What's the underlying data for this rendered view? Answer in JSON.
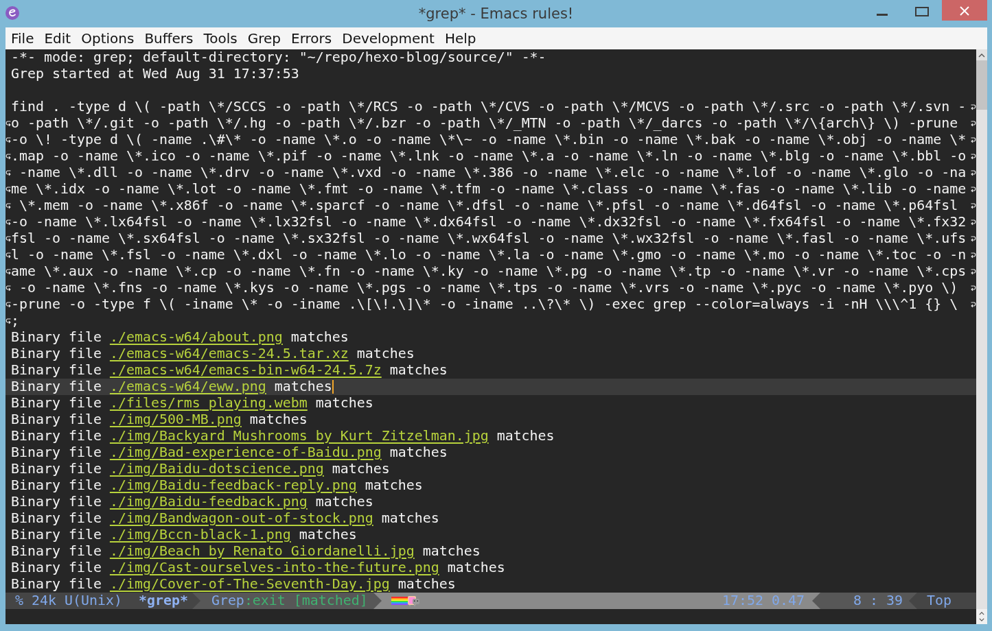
{
  "window": {
    "title": "*grep* - Emacs rules!"
  },
  "menu_bar": [
    "File",
    "Edit",
    "Options",
    "Buffers",
    "Tools",
    "Grep",
    "Errors",
    "Development",
    "Help"
  ],
  "buffer": {
    "header_lines": [
      "-*- mode: grep; default-directory: \"~/repo/hexo-blog/source/\" -*-",
      "Grep started at Wed Aug 31 17:37:53"
    ],
    "command_rows": [
      "find . -type d \\( -path \\*/SCCS -o -path \\*/RCS -o -path \\*/CVS -o -path \\*/MCVS -o -path \\*/.src -o -path \\*/.svn -",
      "o -path \\*/.git -o -path \\*/.hg -o -path \\*/.bzr -o -path \\*/_MTN -o -path \\*/_darcs -o -path \\*/\\{arch\\} \\) -prune",
      "-o \\! -type d \\( -name .\\#\\* -o -name \\*.o -o -name \\*\\~ -o -name \\*.bin -o -name \\*.bak -o -name \\*.obj -o -name \\*",
      ".map -o -name \\*.ico -o -name \\*.pif -o -name \\*.lnk -o -name \\*.a -o -name \\*.ln -o -name \\*.blg -o -name \\*.bbl -o",
      " -name \\*.dll -o -name \\*.drv -o -name \\*.vxd -o -name \\*.386 -o -name \\*.elc -o -name \\*.lof -o -name \\*.glo -o -na",
      "me \\*.idx -o -name \\*.lot -o -name \\*.fmt -o -name \\*.tfm -o -name \\*.class -o -name \\*.fas -o -name \\*.lib -o -name",
      " \\*.mem -o -name \\*.x86f -o -name \\*.sparcf -o -name \\*.dfsl -o -name \\*.pfsl -o -name \\*.d64fsl -o -name \\*.p64fsl",
      "-o -name \\*.lx64fsl -o -name \\*.lx32fsl -o -name \\*.dx64fsl -o -name \\*.dx32fsl -o -name \\*.fx64fsl -o -name \\*.fx32",
      "fsl -o -name \\*.sx64fsl -o -name \\*.sx32fsl -o -name \\*.wx64fsl -o -name \\*.wx32fsl -o -name \\*.fasl -o -name \\*.ufs",
      "l -o -name \\*.fsl -o -name \\*.dxl -o -name \\*.lo -o -name \\*.la -o -name \\*.gmo -o -name \\*.mo -o -name \\*.toc -o -n",
      "ame \\*.aux -o -name \\*.cp -o -name \\*.fn -o -name \\*.ky -o -name \\*.pg -o -name \\*.tp -o -name \\*.vr -o -name \\*.cps",
      " -o -name \\*.fns -o -name \\*.kys -o -name \\*.pgs -o -name \\*.tps -o -name \\*.vrs -o -name \\*.pyc -o -name \\*.pyo \\)",
      "-prune -o -type f \\( -iname \\* -o -iname .\\[\\!.\\]\\* -o -iname ..\\?\\* \\) -exec grep --color=always -i -nH \\\\\\^1 {} \\",
      ";"
    ],
    "results": [
      {
        "prefix": "Binary file",
        "path": "./emacs-w64/about.png",
        "suffix": "matches",
        "selected": false
      },
      {
        "prefix": "Binary file",
        "path": "./emacs-w64/emacs-24.5.tar.xz",
        "suffix": "matches",
        "selected": false
      },
      {
        "prefix": "Binary file",
        "path": "./emacs-w64/emacs-bin-w64-24.5.7z",
        "suffix": "matches",
        "selected": false
      },
      {
        "prefix": "Binary file",
        "path": "./emacs-w64/eww.png",
        "suffix": "matches",
        "selected": true
      },
      {
        "prefix": "Binary file",
        "path": "./files/rms_playing.webm",
        "suffix": "matches",
        "selected": false
      },
      {
        "prefix": "Binary file",
        "path": "./img/500-MB.png",
        "suffix": "matches",
        "selected": false
      },
      {
        "prefix": "Binary file",
        "path": "./img/Backyard_Mushrooms_by_Kurt_Zitzelman.jpg",
        "suffix": "matches",
        "selected": false
      },
      {
        "prefix": "Binary file",
        "path": "./img/Bad-experience-of-Baidu.png",
        "suffix": "matches",
        "selected": false
      },
      {
        "prefix": "Binary file",
        "path": "./img/Baidu-dotscience.png",
        "suffix": "matches",
        "selected": false
      },
      {
        "prefix": "Binary file",
        "path": "./img/Baidu-feedback-reply.png",
        "suffix": "matches",
        "selected": false
      },
      {
        "prefix": "Binary file",
        "path": "./img/Baidu-feedback.png",
        "suffix": "matches",
        "selected": false
      },
      {
        "prefix": "Binary file",
        "path": "./img/Bandwagon-out-of-stock.png",
        "suffix": "matches",
        "selected": false
      },
      {
        "prefix": "Binary file",
        "path": "./img/Bccn-black-1.png",
        "suffix": "matches",
        "selected": false
      },
      {
        "prefix": "Binary file",
        "path": "./img/Beach_by_Renato_Giordanelli.jpg",
        "suffix": "matches",
        "selected": false
      },
      {
        "prefix": "Binary file",
        "path": "./img/Cast-ourselves-into-the-future.png",
        "suffix": "matches",
        "selected": false
      },
      {
        "prefix": "Binary file",
        "path": "./img/Cover-of-The-Seventh-Day.jpg",
        "suffix": "matches",
        "selected": false
      }
    ]
  },
  "mode_line": {
    "status": "% 24k U(Unix)",
    "buffer_name": "*grep*",
    "major_mode": "Grep",
    "process_status": ":exit [matched]",
    "time_load": "17:52 0.47",
    "position": "8 : 39",
    "scroll_position": "Top"
  }
}
